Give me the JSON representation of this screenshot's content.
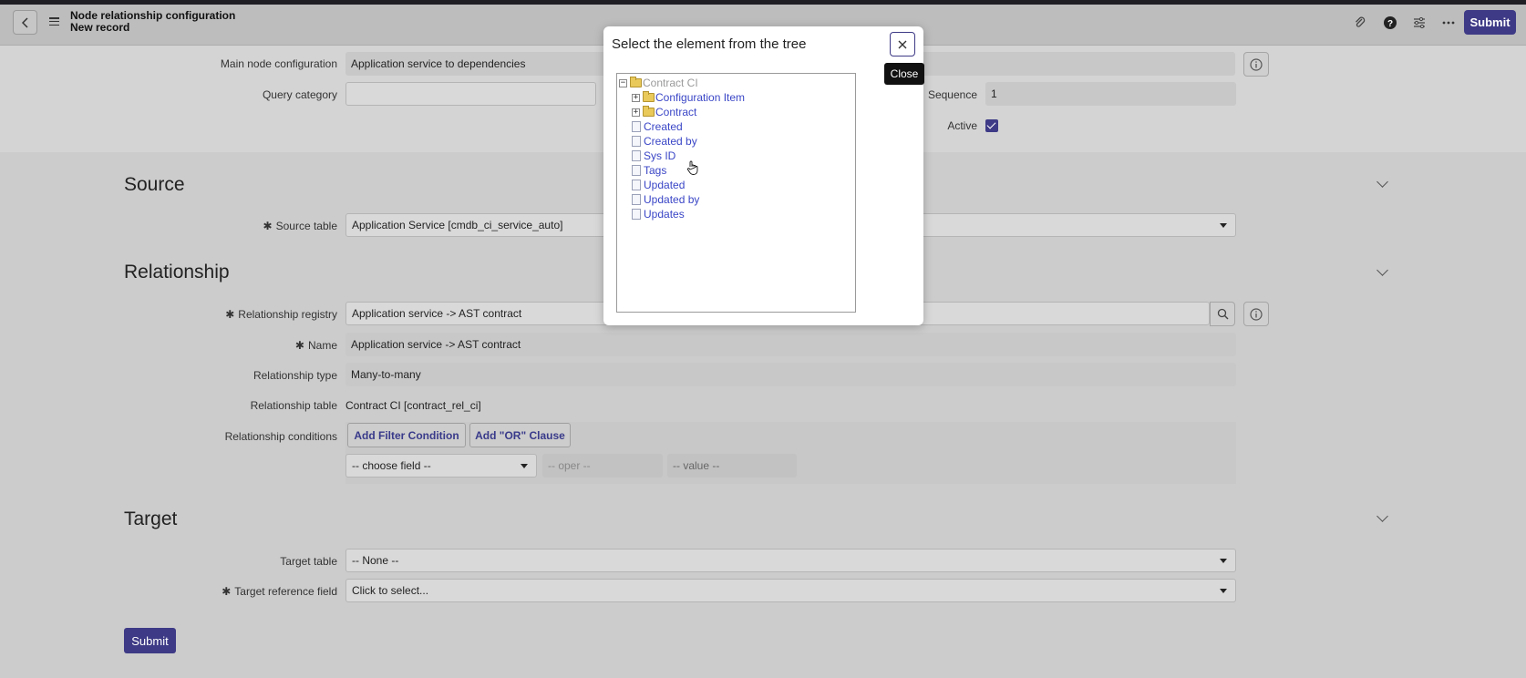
{
  "header": {
    "title_line1": "Node relationship configuration",
    "title_line2": "New record",
    "submit_label": "Submit"
  },
  "top_form": {
    "main_node_label": "Main node configuration",
    "main_node_value": "Application service to dependencies",
    "query_category_label": "Query category",
    "query_category_value": "",
    "sequence_label": "Sequence",
    "sequence_value": "1",
    "active_label": "Active",
    "active_checked": true
  },
  "source": {
    "title": "Source",
    "source_table_label": "Source table",
    "source_table_value": "Application Service [cmdb_ci_service_auto]"
  },
  "relationship": {
    "title": "Relationship",
    "registry_label": "Relationship registry",
    "registry_value": "Application service -> AST contract",
    "name_label": "Name",
    "name_value": "Application service -> AST contract",
    "type_label": "Relationship type",
    "type_value": "Many-to-many",
    "table_label": "Relationship table",
    "table_value": "Contract CI [contract_rel_ci]",
    "conditions_label": "Relationship conditions",
    "add_filter_label": "Add Filter Condition",
    "add_or_label": "Add \"OR\" Clause",
    "choose_field": "-- choose field --",
    "oper": "-- oper --",
    "value": "-- value --"
  },
  "target": {
    "title": "Target",
    "target_table_label": "Target table",
    "target_table_value": "-- None --",
    "target_ref_label": "Target reference field",
    "target_ref_value": "Click to select..."
  },
  "bottom": {
    "submit_label": "Submit"
  },
  "modal": {
    "title": "Select the element from the tree",
    "close_tooltip": "Close",
    "tree": {
      "root": "Contract CI",
      "folders": [
        "Configuration Item",
        "Contract"
      ],
      "leaves": [
        "Created",
        "Created by",
        "Sys ID",
        "Tags",
        "Updated",
        "Updated by",
        "Updates"
      ]
    }
  },
  "colors": {
    "accent": "#3e3a86",
    "tree_link": "#3a46c6",
    "overlay_bg": "#d4d4d4"
  }
}
